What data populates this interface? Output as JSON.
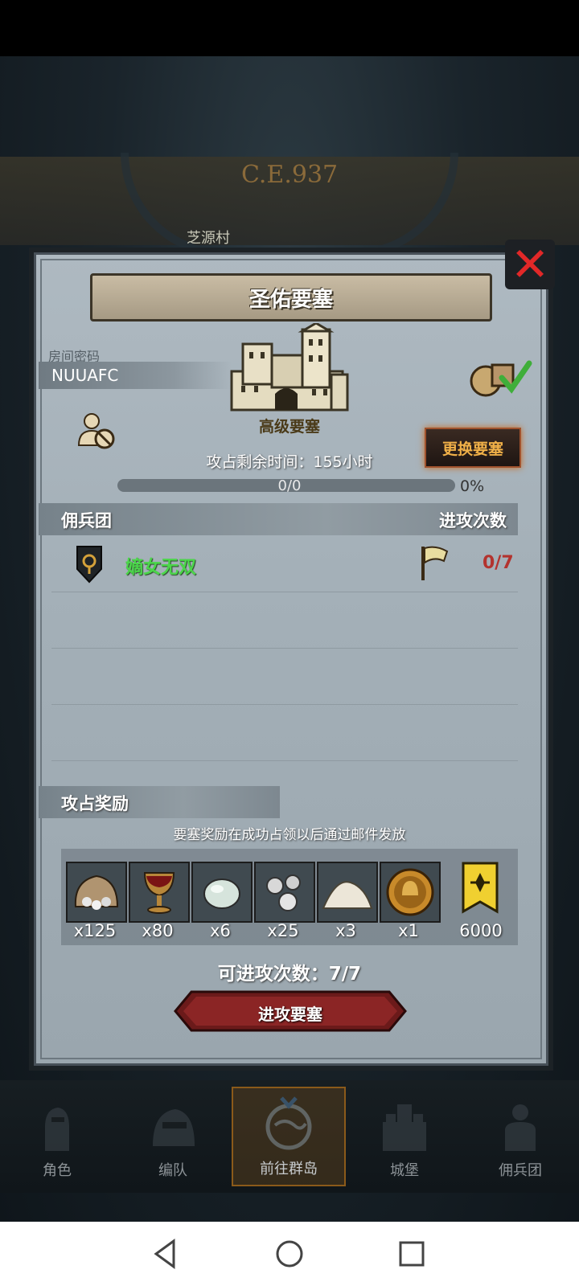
{
  "background": {
    "year": "C.E.937",
    "village": "芝源村"
  },
  "dialog": {
    "title": "圣佑要塞",
    "room": {
      "label": "房间密码",
      "code": "NUUAFC"
    },
    "fortress_type": "高级要塞",
    "change_button": "更换要塞",
    "remaining_time": "攻占剩余时间：155小时",
    "progress": {
      "count": "0/0",
      "percent": "0%",
      "fraction": 0
    },
    "mercenary_header": {
      "left": "佣兵团",
      "right": "进攻次数"
    },
    "mercenaries": [
      {
        "name": "嫡女无双",
        "attacks": "0/7"
      }
    ],
    "rewards_title": "攻占奖励",
    "rewards_note": "要塞奖励在成功占领以后通过邮件发放",
    "rewards": [
      {
        "icon": "ore-sack-icon",
        "qty": "x125"
      },
      {
        "icon": "goblet-icon",
        "qty": "x80"
      },
      {
        "icon": "gem-icon",
        "qty": "x6"
      },
      {
        "icon": "silver-orbs-icon",
        "qty": "x25"
      },
      {
        "icon": "powder-pile-icon",
        "qty": "x3"
      },
      {
        "icon": "helmet-medal-icon",
        "qty": "x1"
      },
      {
        "icon": "banner-emblem-icon",
        "qty": "6000"
      }
    ],
    "attacks_available": "可进攻次数：7/7",
    "attack_button": "进攻要塞"
  },
  "bottom_nav": [
    {
      "label": "角色",
      "icon": "knight-icon"
    },
    {
      "label": "编队",
      "icon": "helmet-icon"
    },
    {
      "label": "前往群岛",
      "icon": "globe-icon",
      "active": true
    },
    {
      "label": "城堡",
      "icon": "castle-icon"
    },
    {
      "label": "佣兵团",
      "icon": "soldier-icon"
    }
  ],
  "colors": {
    "accent_orange": "#f0b048",
    "guild_green": "#4bd64a",
    "count_red": "#b3332e",
    "close_red": "#e12828"
  }
}
